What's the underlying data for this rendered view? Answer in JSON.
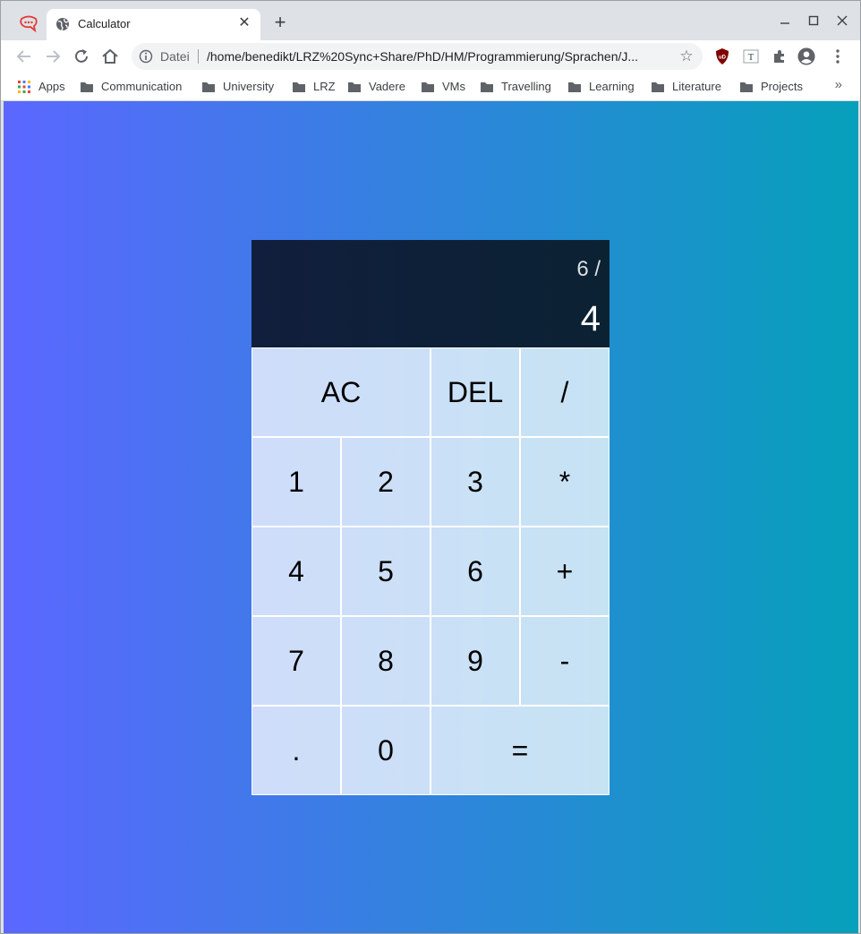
{
  "browser": {
    "tab_title": "Calculator",
    "omnibox": {
      "scheme_label": "Datei",
      "url": "/home/benedikt/LRZ%20Sync+Share/PhD/HM/Programmierung/Sprachen/J..."
    },
    "bookmarks": [
      {
        "label": "Apps",
        "icon": "apps-grid-icon"
      },
      {
        "label": "Communication",
        "icon": "folder-icon"
      },
      {
        "label": "University",
        "icon": "folder-icon"
      },
      {
        "label": "LRZ",
        "icon": "folder-icon"
      },
      {
        "label": "Vadere",
        "icon": "folder-icon"
      },
      {
        "label": "VMs",
        "icon": "folder-icon"
      },
      {
        "label": "Travelling",
        "icon": "folder-icon"
      },
      {
        "label": "Learning",
        "icon": "folder-icon"
      },
      {
        "label": "Literature",
        "icon": "folder-icon"
      },
      {
        "label": "Projects",
        "icon": "folder-icon"
      }
    ],
    "more_bookmarks": "»"
  },
  "calculator": {
    "previous_operand": "6 /",
    "current_operand": "4",
    "keys": {
      "ac": "AC",
      "del": "DEL",
      "divide": "/",
      "one": "1",
      "two": "2",
      "three": "3",
      "multiply": "*",
      "four": "4",
      "five": "5",
      "six": "6",
      "add": "+",
      "seven": "7",
      "eight": "8",
      "nine": "9",
      "subtract": "-",
      "decimal": ".",
      "zero": "0",
      "equals": "="
    }
  },
  "colors": {
    "background_gradient_start": "#5b67ff",
    "background_gradient_end": "#06a0bb",
    "display_background": "#0f1f3d",
    "key_background": "rgba(255,255,255,0.75)"
  }
}
